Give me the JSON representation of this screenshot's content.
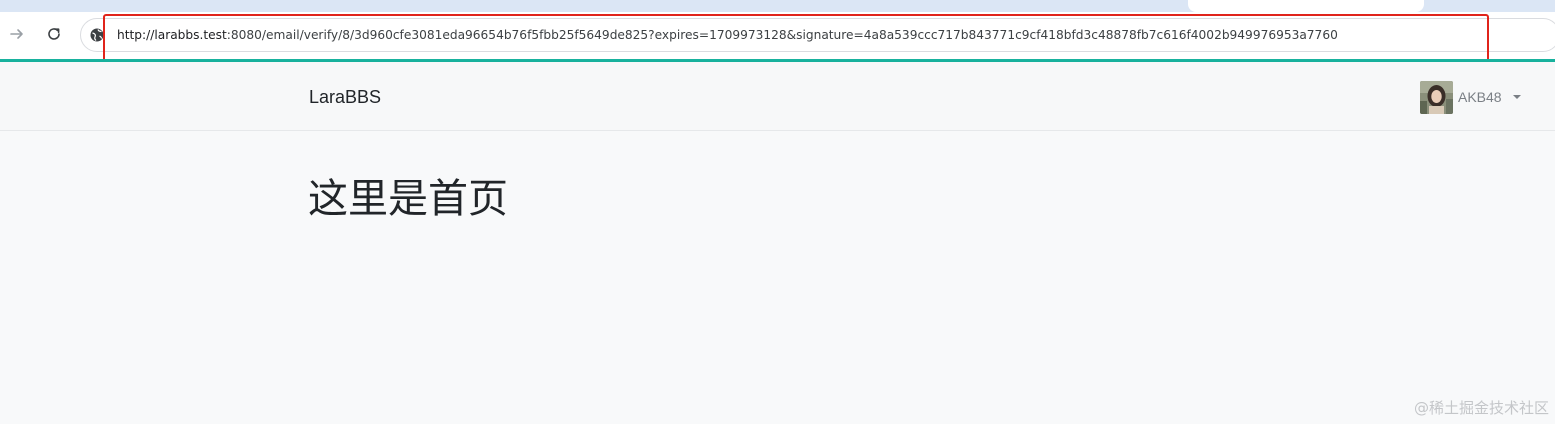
{
  "browser": {
    "url_host": "http://larabbs.test",
    "url_path": ":8080/email/verify/8/3d960cfe3081eda96654b76f5fbb25f5649de825?expires=1709973128&signature=4a8a539ccc717b843771c9cf418bfd3c48878fb7c616f4002b949976953a7760",
    "icons": {
      "forward": "arrow-right-icon",
      "reload": "reload-icon",
      "site_info": "globe-icon"
    },
    "accent_color": "#18b29e",
    "annotation_color": "#e0241b"
  },
  "navbar": {
    "brand": "LaraBBS",
    "user": {
      "name": "AKB48",
      "avatar_icon": "user-avatar-photo"
    }
  },
  "main": {
    "heading": "这里是首页"
  },
  "watermark": "@稀土掘金技术社区"
}
